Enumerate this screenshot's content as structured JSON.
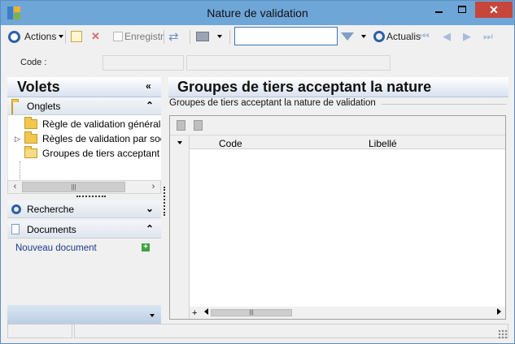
{
  "window": {
    "title": "Nature de validation"
  },
  "toolbar": {
    "actions_label": "Actions",
    "save_label": "Enregistr",
    "search_value": "",
    "refresh_label": "Actualis"
  },
  "code_row": {
    "label": "Code :",
    "code_value": "",
    "libelle_value": ""
  },
  "left_panel": {
    "title": "Volets",
    "onglets": {
      "label": "Onglets",
      "items": [
        {
          "label": "Règle de validation générale"
        },
        {
          "label": "Règles de validation par soc"
        },
        {
          "label": "Groupes de tiers acceptant l"
        }
      ]
    },
    "recherche_label": "Recherche",
    "documents": {
      "label": "Documents",
      "new_doc_label": "Nouveau document"
    }
  },
  "main": {
    "title": "Groupes de tiers acceptant la nature",
    "group_label": "Groupes de tiers acceptant la nature de validation",
    "columns": [
      "Code",
      "Libellé"
    ],
    "rows": []
  },
  "colors": {
    "titlebar": "#6fa6d8",
    "close_button": "#c7463b",
    "accent": "#2d5fa8"
  }
}
